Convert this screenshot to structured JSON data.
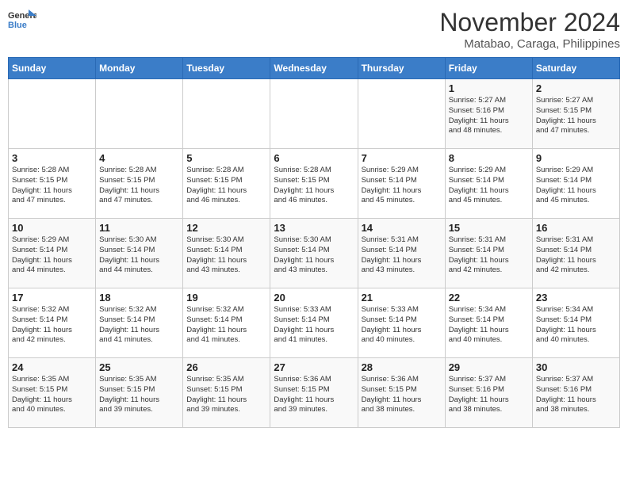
{
  "header": {
    "logo_line1": "General",
    "logo_line2": "Blue",
    "month": "November 2024",
    "location": "Matabao, Caraga, Philippines"
  },
  "weekdays": [
    "Sunday",
    "Monday",
    "Tuesday",
    "Wednesday",
    "Thursday",
    "Friday",
    "Saturday"
  ],
  "weeks": [
    [
      {
        "day": "",
        "info": ""
      },
      {
        "day": "",
        "info": ""
      },
      {
        "day": "",
        "info": ""
      },
      {
        "day": "",
        "info": ""
      },
      {
        "day": "",
        "info": ""
      },
      {
        "day": "1",
        "info": "Sunrise: 5:27 AM\nSunset: 5:16 PM\nDaylight: 11 hours\nand 48 minutes."
      },
      {
        "day": "2",
        "info": "Sunrise: 5:27 AM\nSunset: 5:15 PM\nDaylight: 11 hours\nand 47 minutes."
      }
    ],
    [
      {
        "day": "3",
        "info": "Sunrise: 5:28 AM\nSunset: 5:15 PM\nDaylight: 11 hours\nand 47 minutes."
      },
      {
        "day": "4",
        "info": "Sunrise: 5:28 AM\nSunset: 5:15 PM\nDaylight: 11 hours\nand 47 minutes."
      },
      {
        "day": "5",
        "info": "Sunrise: 5:28 AM\nSunset: 5:15 PM\nDaylight: 11 hours\nand 46 minutes."
      },
      {
        "day": "6",
        "info": "Sunrise: 5:28 AM\nSunset: 5:15 PM\nDaylight: 11 hours\nand 46 minutes."
      },
      {
        "day": "7",
        "info": "Sunrise: 5:29 AM\nSunset: 5:14 PM\nDaylight: 11 hours\nand 45 minutes."
      },
      {
        "day": "8",
        "info": "Sunrise: 5:29 AM\nSunset: 5:14 PM\nDaylight: 11 hours\nand 45 minutes."
      },
      {
        "day": "9",
        "info": "Sunrise: 5:29 AM\nSunset: 5:14 PM\nDaylight: 11 hours\nand 45 minutes."
      }
    ],
    [
      {
        "day": "10",
        "info": "Sunrise: 5:29 AM\nSunset: 5:14 PM\nDaylight: 11 hours\nand 44 minutes."
      },
      {
        "day": "11",
        "info": "Sunrise: 5:30 AM\nSunset: 5:14 PM\nDaylight: 11 hours\nand 44 minutes."
      },
      {
        "day": "12",
        "info": "Sunrise: 5:30 AM\nSunset: 5:14 PM\nDaylight: 11 hours\nand 43 minutes."
      },
      {
        "day": "13",
        "info": "Sunrise: 5:30 AM\nSunset: 5:14 PM\nDaylight: 11 hours\nand 43 minutes."
      },
      {
        "day": "14",
        "info": "Sunrise: 5:31 AM\nSunset: 5:14 PM\nDaylight: 11 hours\nand 43 minutes."
      },
      {
        "day": "15",
        "info": "Sunrise: 5:31 AM\nSunset: 5:14 PM\nDaylight: 11 hours\nand 42 minutes."
      },
      {
        "day": "16",
        "info": "Sunrise: 5:31 AM\nSunset: 5:14 PM\nDaylight: 11 hours\nand 42 minutes."
      }
    ],
    [
      {
        "day": "17",
        "info": "Sunrise: 5:32 AM\nSunset: 5:14 PM\nDaylight: 11 hours\nand 42 minutes."
      },
      {
        "day": "18",
        "info": "Sunrise: 5:32 AM\nSunset: 5:14 PM\nDaylight: 11 hours\nand 41 minutes."
      },
      {
        "day": "19",
        "info": "Sunrise: 5:32 AM\nSunset: 5:14 PM\nDaylight: 11 hours\nand 41 minutes."
      },
      {
        "day": "20",
        "info": "Sunrise: 5:33 AM\nSunset: 5:14 PM\nDaylight: 11 hours\nand 41 minutes."
      },
      {
        "day": "21",
        "info": "Sunrise: 5:33 AM\nSunset: 5:14 PM\nDaylight: 11 hours\nand 40 minutes."
      },
      {
        "day": "22",
        "info": "Sunrise: 5:34 AM\nSunset: 5:14 PM\nDaylight: 11 hours\nand 40 minutes."
      },
      {
        "day": "23",
        "info": "Sunrise: 5:34 AM\nSunset: 5:14 PM\nDaylight: 11 hours\nand 40 minutes."
      }
    ],
    [
      {
        "day": "24",
        "info": "Sunrise: 5:35 AM\nSunset: 5:15 PM\nDaylight: 11 hours\nand 40 minutes."
      },
      {
        "day": "25",
        "info": "Sunrise: 5:35 AM\nSunset: 5:15 PM\nDaylight: 11 hours\nand 39 minutes."
      },
      {
        "day": "26",
        "info": "Sunrise: 5:35 AM\nSunset: 5:15 PM\nDaylight: 11 hours\nand 39 minutes."
      },
      {
        "day": "27",
        "info": "Sunrise: 5:36 AM\nSunset: 5:15 PM\nDaylight: 11 hours\nand 39 minutes."
      },
      {
        "day": "28",
        "info": "Sunrise: 5:36 AM\nSunset: 5:15 PM\nDaylight: 11 hours\nand 38 minutes."
      },
      {
        "day": "29",
        "info": "Sunrise: 5:37 AM\nSunset: 5:16 PM\nDaylight: 11 hours\nand 38 minutes."
      },
      {
        "day": "30",
        "info": "Sunrise: 5:37 AM\nSunset: 5:16 PM\nDaylight: 11 hours\nand 38 minutes."
      }
    ]
  ]
}
